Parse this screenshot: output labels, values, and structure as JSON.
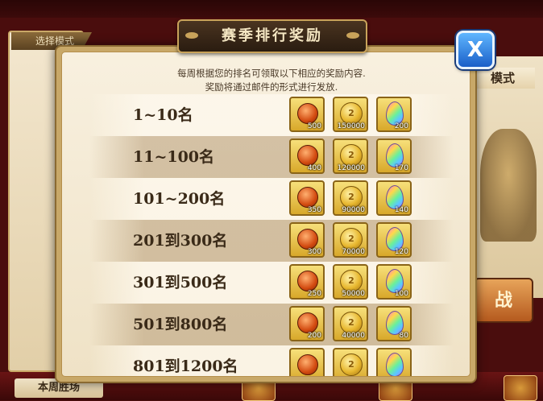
{
  "background": {
    "mode_tab": "选择模式",
    "right_title": "模式",
    "battle_button": "战",
    "bottom_label": "本周胜场"
  },
  "modal": {
    "title": "赛季排行奖励",
    "close_label": "X",
    "description_line1": "每周根据您的排名可领取以下相应的奖励内容.",
    "description_line2": "奖励将通过邮件的形式进行发放.",
    "columns": [
      "token",
      "gold",
      "gem"
    ],
    "rows": [
      {
        "rank": "1~10名",
        "token": "500",
        "gold": "150000",
        "gem": "200"
      },
      {
        "rank": "11~100名",
        "token": "400",
        "gold": "120000",
        "gem": "170"
      },
      {
        "rank": "101~200名",
        "token": "350",
        "gold": "90000",
        "gem": "140"
      },
      {
        "rank": "201到300名",
        "token": "300",
        "gold": "70000",
        "gem": "120"
      },
      {
        "rank": "301到500名",
        "token": "250",
        "gold": "50000",
        "gem": "100"
      },
      {
        "rank": "501到800名",
        "token": "200",
        "gold": "40000",
        "gem": "80"
      },
      {
        "rank": "801到1200名",
        "token": "",
        "gold": "",
        "gem": ""
      }
    ]
  },
  "icons": {
    "token": "orange-medal-icon",
    "gold": "gold-coin-icon",
    "gem": "rainbow-gem-icon"
  },
  "colors": {
    "close_button": "#1a5fc8",
    "title_plate": "#2a1c10",
    "reward_frame": "#d8a82a"
  }
}
